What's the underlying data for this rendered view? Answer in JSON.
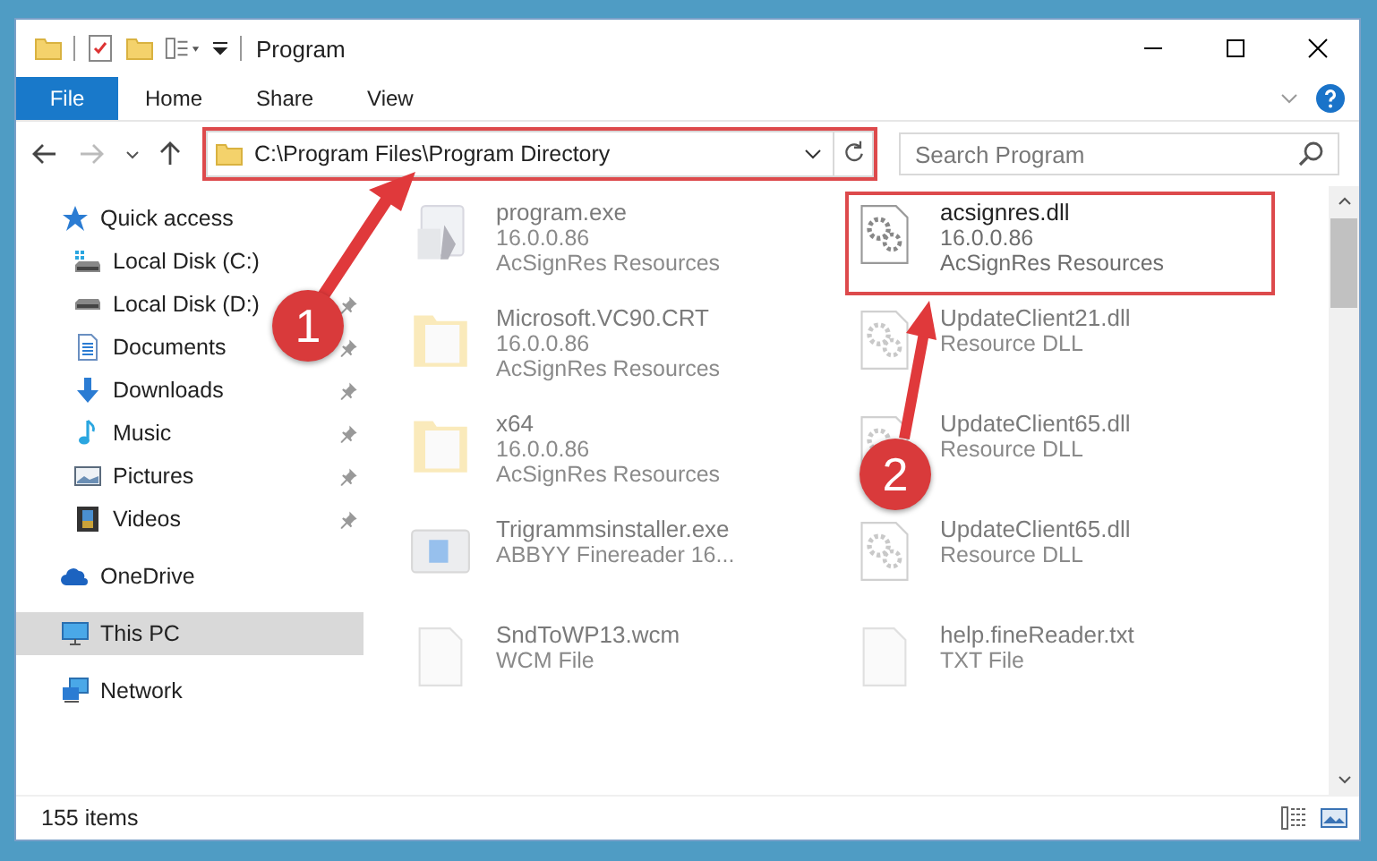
{
  "window": {
    "title": "Program"
  },
  "ribbon_tabs": [
    {
      "label": "File",
      "kind": "menu"
    },
    {
      "label": "Home",
      "kind": "tab"
    },
    {
      "label": "Share",
      "kind": "tab"
    },
    {
      "label": "View",
      "kind": "tab"
    }
  ],
  "address_bar": {
    "path": "C:\\Program Files\\Program Directory",
    "highlighted": true
  },
  "search": {
    "placeholder": "Search Program"
  },
  "navigation": [
    {
      "label": "Quick access",
      "kind": "star",
      "selected": false,
      "children": [
        {
          "label": "Local Disk (C:)",
          "kind": "drive-c",
          "pinned": false
        },
        {
          "label": "Local Disk (D:)",
          "kind": "drive",
          "pinned": true
        },
        {
          "label": "Documents",
          "kind": "documents",
          "pinned": true
        },
        {
          "label": "Downloads",
          "kind": "downloads",
          "pinned": true
        },
        {
          "label": "Music",
          "kind": "music",
          "pinned": true
        },
        {
          "label": "Pictures",
          "kind": "pictures",
          "pinned": true
        },
        {
          "label": "Videos",
          "kind": "videos",
          "pinned": true
        }
      ]
    },
    {
      "label": "OneDrive",
      "kind": "cloud",
      "selected": false
    },
    {
      "label": "This PC",
      "kind": "pc",
      "selected": true
    },
    {
      "label": "Network",
      "kind": "network",
      "selected": false
    }
  ],
  "files": [
    {
      "name": "program.exe",
      "details": [
        "16.0.0.86",
        "AcSignRes Resources"
      ],
      "kind": "exe",
      "faded": true,
      "highlighted": false
    },
    {
      "name": "acsignres.dll",
      "details": [
        "16.0.0.86",
        "AcSignRes Resources"
      ],
      "kind": "dll",
      "faded": false,
      "highlighted": true
    },
    {
      "name": "Microsoft.VC90.CRT",
      "details": [
        "16.0.0.86",
        "AcSignRes Resources"
      ],
      "kind": "folder",
      "faded": true,
      "highlighted": false
    },
    {
      "name": "UpdateClient21.dll",
      "details": [
        "Resource DLL"
      ],
      "kind": "dll",
      "faded": true,
      "highlighted": false
    },
    {
      "name": "x64",
      "details": [
        "16.0.0.86",
        "AcSignRes Resources"
      ],
      "kind": "folder",
      "faded": true,
      "highlighted": false
    },
    {
      "name": "UpdateClient65.dll",
      "details": [
        "Resource DLL"
      ],
      "kind": "dll",
      "faded": true,
      "highlighted": false
    },
    {
      "name": "Trigrammsinstaller.exe",
      "details": [
        "ABBYY Finereader 16..."
      ],
      "kind": "installer",
      "faded": true,
      "highlighted": false
    },
    {
      "name": "UpdateClient65.dll",
      "details": [
        "Resource DLL"
      ],
      "kind": "dll",
      "faded": true,
      "highlighted": false
    },
    {
      "name": "SndToWP13.wcm",
      "details": [
        "WCM File"
      ],
      "kind": "file",
      "faded": true,
      "highlighted": false
    },
    {
      "name": "help.fineReader.txt",
      "details": [
        "TXT File"
      ],
      "kind": "file",
      "faded": true,
      "highlighted": false
    }
  ],
  "status_bar": {
    "item_count": "155 items"
  },
  "callouts": [
    {
      "label": "1"
    },
    {
      "label": "2"
    }
  ]
}
